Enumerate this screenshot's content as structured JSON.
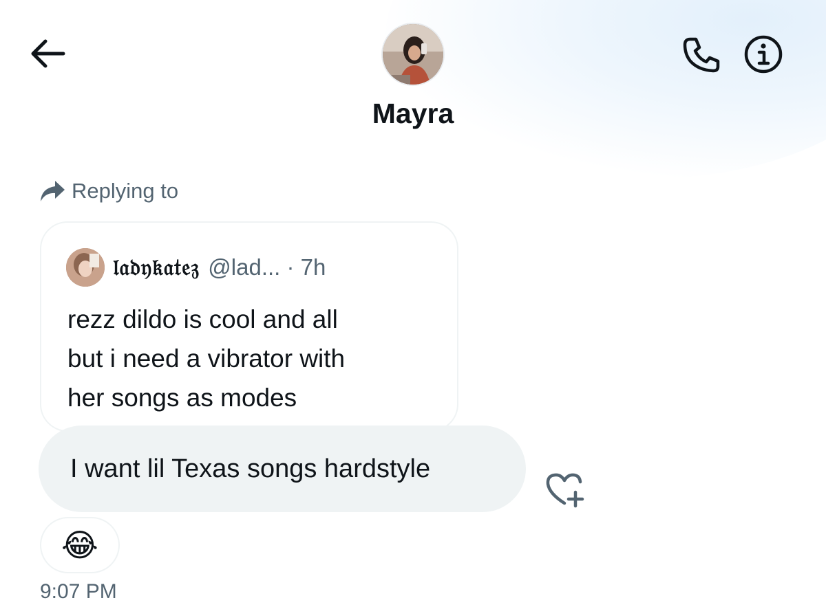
{
  "header": {
    "contact_name": "Mayra",
    "back_icon": "arrow-left-icon",
    "call_icon": "phone-icon",
    "info_icon": "info-icon"
  },
  "reply": {
    "label": "Replying to",
    "icon": "reply-arrow-icon"
  },
  "quoted_post": {
    "author_name": "𝔩𝔞𝔡𝔶𝔨𝔞𝔱𝔢𝔷",
    "handle_time": "@lad... · 7h",
    "lines": [
      "rezz dildo is cool and all",
      "but i need a vibrator with",
      "her songs as modes"
    ]
  },
  "message": {
    "text": "I want lil Texas songs hardstyle",
    "reaction_emoji": "😂",
    "timestamp": "9:07 PM",
    "add_reaction_icon": "heart-plus-icon"
  },
  "colors": {
    "text_primary": "#0f1419",
    "text_secondary": "#536471",
    "bubble_bg": "#eff3f4",
    "border": "#eff3f4"
  }
}
